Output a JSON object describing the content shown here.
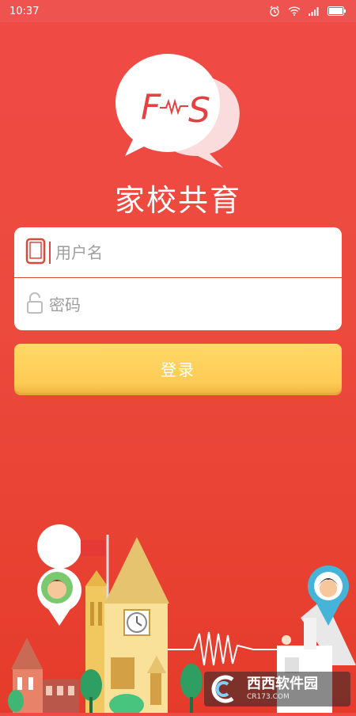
{
  "status_bar": {
    "time": "10:37"
  },
  "logo": {
    "letters_left": "F",
    "letters_right": "S"
  },
  "app": {
    "title": "家校共育"
  },
  "form": {
    "username_placeholder": "用户名",
    "password_placeholder": "密码",
    "login_label": "登录"
  },
  "icons": {
    "phone": "phone-icon",
    "lock": "unlock-icon",
    "alarm": "alarm-icon",
    "wifi": "wifi-icon",
    "signal": "signal-icon",
    "battery": "battery-icon"
  },
  "watermark": {
    "title": "西西软件园",
    "subtitle": "CR173.COM"
  },
  "colors": {
    "background": "#ec4a3d",
    "button": "#fecb55",
    "accent": "#d84b3a"
  }
}
